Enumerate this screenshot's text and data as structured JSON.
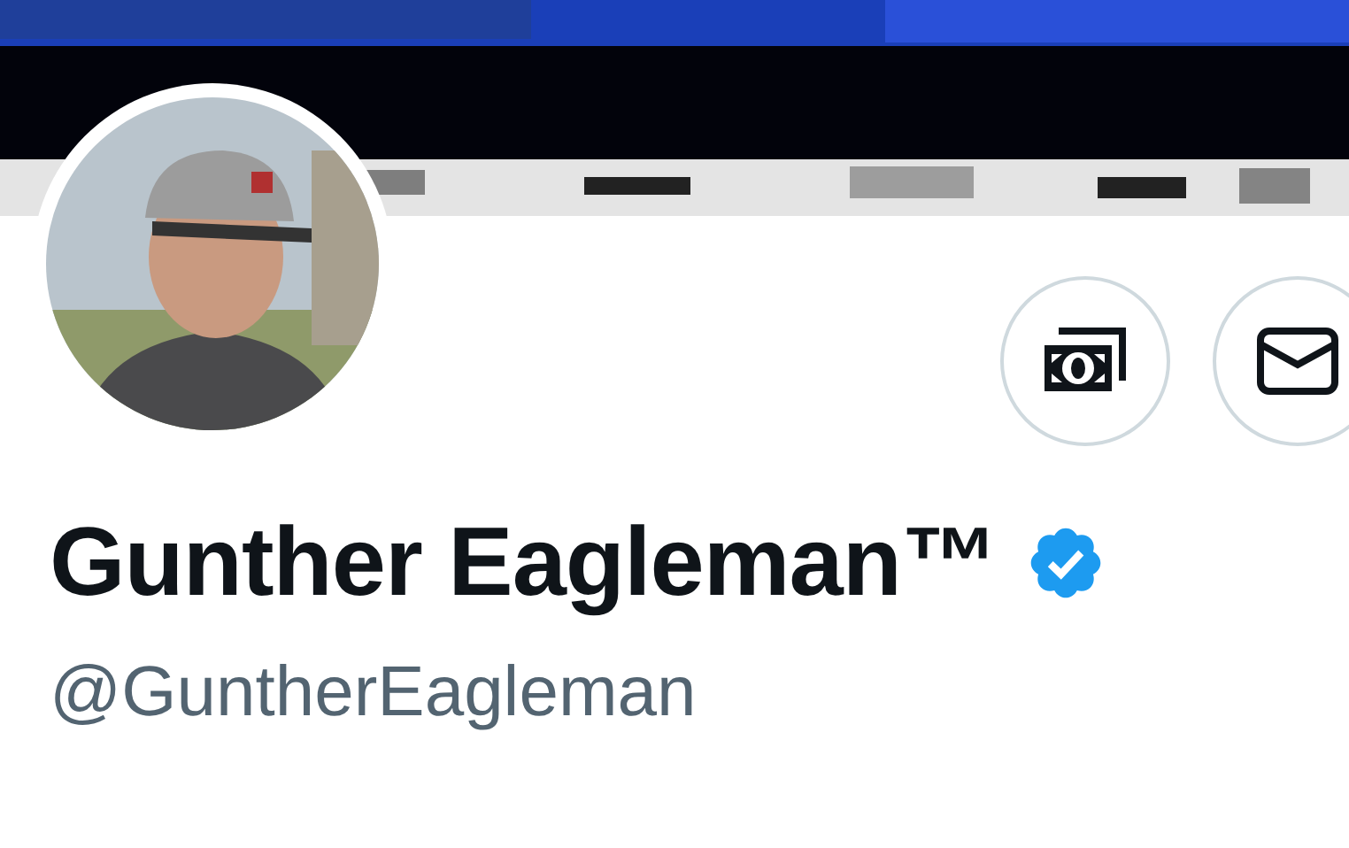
{
  "profile": {
    "name": "Gunther Eagleman™",
    "verified": true,
    "handle": "@GuntherEagleman"
  }
}
